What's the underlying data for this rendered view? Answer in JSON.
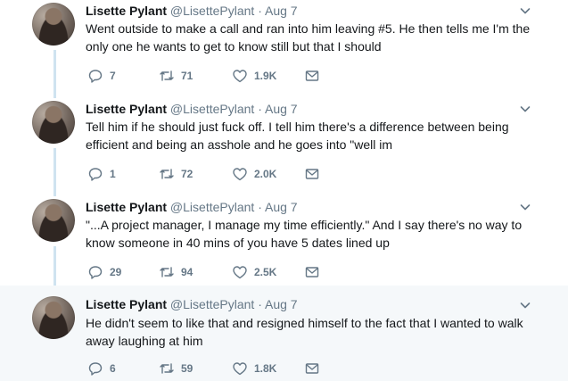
{
  "tweets": [
    {
      "name": "Lisette Pylant",
      "handle": "@LisettePylant",
      "dot": "·",
      "date": "Aug 7",
      "text": "Went outside to make a call and ran into him leaving #5. He then tells me I'm the only one he wants to get to know still but that I should",
      "replies": "7",
      "retweets": "71",
      "likes": "1.9K"
    },
    {
      "name": "Lisette Pylant",
      "handle": "@LisettePylant",
      "dot": "·",
      "date": "Aug 7",
      "text": "Tell him if he should just fuck off. I tell him there's a difference between being efficient and being an asshole and he goes into \"well im",
      "replies": "1",
      "retweets": "72",
      "likes": "2.0K"
    },
    {
      "name": "Lisette Pylant",
      "handle": "@LisettePylant",
      "dot": "·",
      "date": "Aug 7",
      "text": "\"...A project manager, I manage my time efficiently.\" And I say there's no way to know someone in 40 mins of you have 5 dates lined up",
      "replies": "29",
      "retweets": "94",
      "likes": "2.5K"
    },
    {
      "name": "Lisette Pylant",
      "handle": "@LisettePylant",
      "dot": "·",
      "date": "Aug 7",
      "text": "He didn't seem to like that and resigned himself to the fact that I wanted to walk away laughing at him",
      "replies": "6",
      "retweets": "59",
      "likes": "1.8K"
    }
  ],
  "icons": {
    "reply": "reply-icon",
    "retweet": "retweet-icon",
    "like": "heart-icon",
    "dm": "envelope-icon",
    "more": "chevron-down-icon",
    "avatar": "avatar"
  },
  "colors": {
    "text": "#14171a",
    "muted": "#657786",
    "thread_line": "#cfe3f0",
    "highlight_bg": "#f5f8fa"
  }
}
